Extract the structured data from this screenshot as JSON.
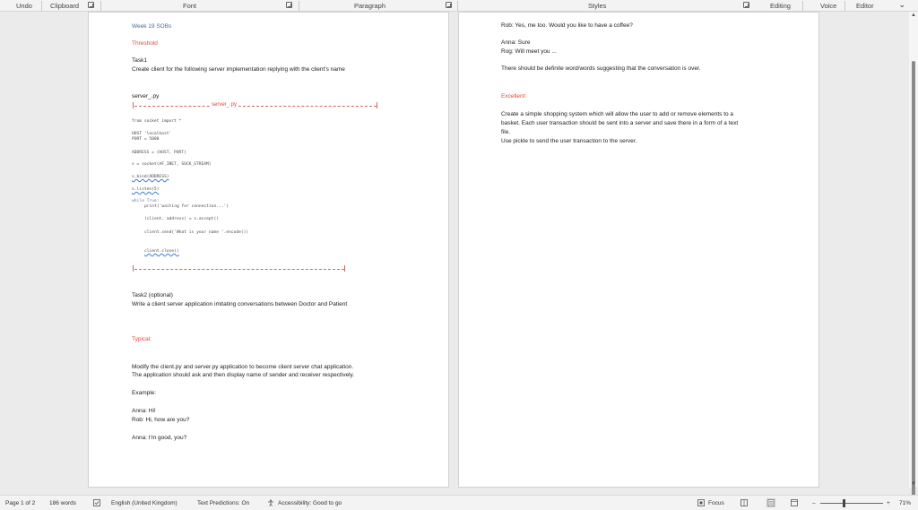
{
  "ribbon": {
    "undo": "Undo",
    "clipboard": "Clipboard",
    "font": "Font",
    "paragraph": "Paragraph",
    "styles": "Styles",
    "editing": "Editing",
    "voice": "Voice",
    "editor": "Editor"
  },
  "page1": {
    "week": "Week 19 SOBs",
    "threshold": "Threshold",
    "task1_title": "Task1",
    "task1_desc": "Create client for the following server implementation replying with the client's name",
    "server_filename": "server_.py",
    "server_banner": "server_.py",
    "code": {
      "line1": "from socket import *",
      "line2": "HOST    'localhost'",
      "line3": "PORT = 5000",
      "line4": "ADDRESS = (HOST, PORT)",
      "line5": "s = socket(AF_INET, SOCK_STREAM)",
      "line6": "s.bind(ADDRESS)",
      "line7": "s.listen(5)",
      "line8": "while True:",
      "line9": "print('waiting for connection...')",
      "line10": "(client, address) = s.accept()",
      "line11": "client.send('What is your name   '.encode())",
      "line12": "client.close()"
    },
    "task2_title": "Task2 (optional)",
    "task2_desc": "Write a client server application imitating conversations between Doctor and Patient",
    "typical": "Typical:",
    "modify1": "Modify the client.py and server.py application to become client server chat application.",
    "modify2": "The application should ask and then display name of sender and receiver respectively.",
    "example": "Example:",
    "ex1": "Anna: Hi!",
    "ex2": "Rob: Hi, how are you?",
    "ex3": "Anna: I'm good, you?"
  },
  "page2": {
    "rob1": "Rob: Yes, me too. Would you like to have a coffee?",
    "anna2": "Anna: Sure",
    "rog": "Rog: Will meet you ...",
    "definite": "There should be definite word/words suggesting that the conversation is over.",
    "excellent": "Excellent:",
    "shop1": "Create a simple shopping system which will allow the user to add or remove elements to a",
    "shop2": "basket. Each user transaction should be sent into a server and save there in a form of a text",
    "shop3": "file.",
    "shop4": "Use pickle to send the user transaction to the server."
  },
  "status": {
    "page": "Page 1 of 2",
    "words": "186 words",
    "language": "English (United Kingdom)",
    "predictions": "Text Predictions: On",
    "accessibility": "Accessibility: Good to go",
    "focus": "Focus",
    "zoom_minus": "–",
    "zoom_plus": "+",
    "zoom": "71%"
  }
}
